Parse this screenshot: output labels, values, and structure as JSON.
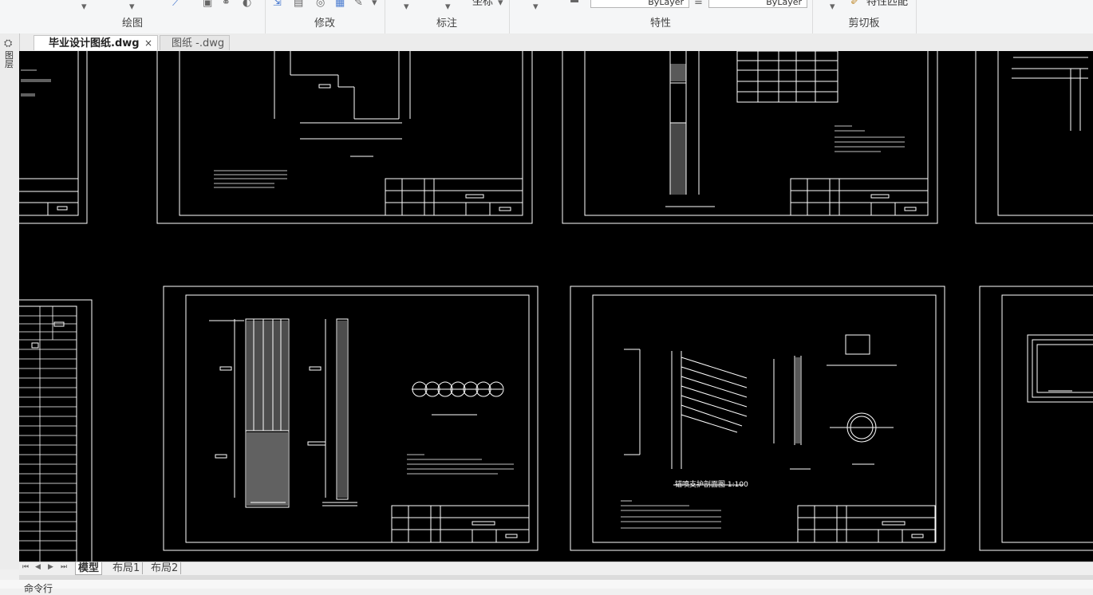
{
  "ribbon": {
    "groups": [
      {
        "label": "绘图"
      },
      {
        "label": "修改"
      },
      {
        "label": "标注"
      },
      {
        "label": "特性"
      },
      {
        "label": "剪切板"
      }
    ],
    "coord_label": "坐标",
    "layer_combo_1": "ByLayer",
    "layer_combo_2": "ByLayer",
    "match_props": "特性匹配"
  },
  "tabs": [
    {
      "label": "毕业设计图纸.dwg",
      "active": true,
      "close": "×"
    },
    {
      "label": "图纸 -.dwg",
      "active": false
    }
  ],
  "side_panel": {
    "label": "图层"
  },
  "layout_tabs": [
    "模型",
    "布局1",
    "布局2"
  ],
  "nav_buttons": [
    "⏮",
    "◀",
    "▶",
    "⏭"
  ],
  "command_line": {
    "label": "命令行"
  },
  "drawing_annotations": {
    "sheet6_caption": "锚喷支护剖面图 1:100"
  },
  "colors": {
    "canvas_bg": "#000000",
    "lines": "#ffffff"
  }
}
